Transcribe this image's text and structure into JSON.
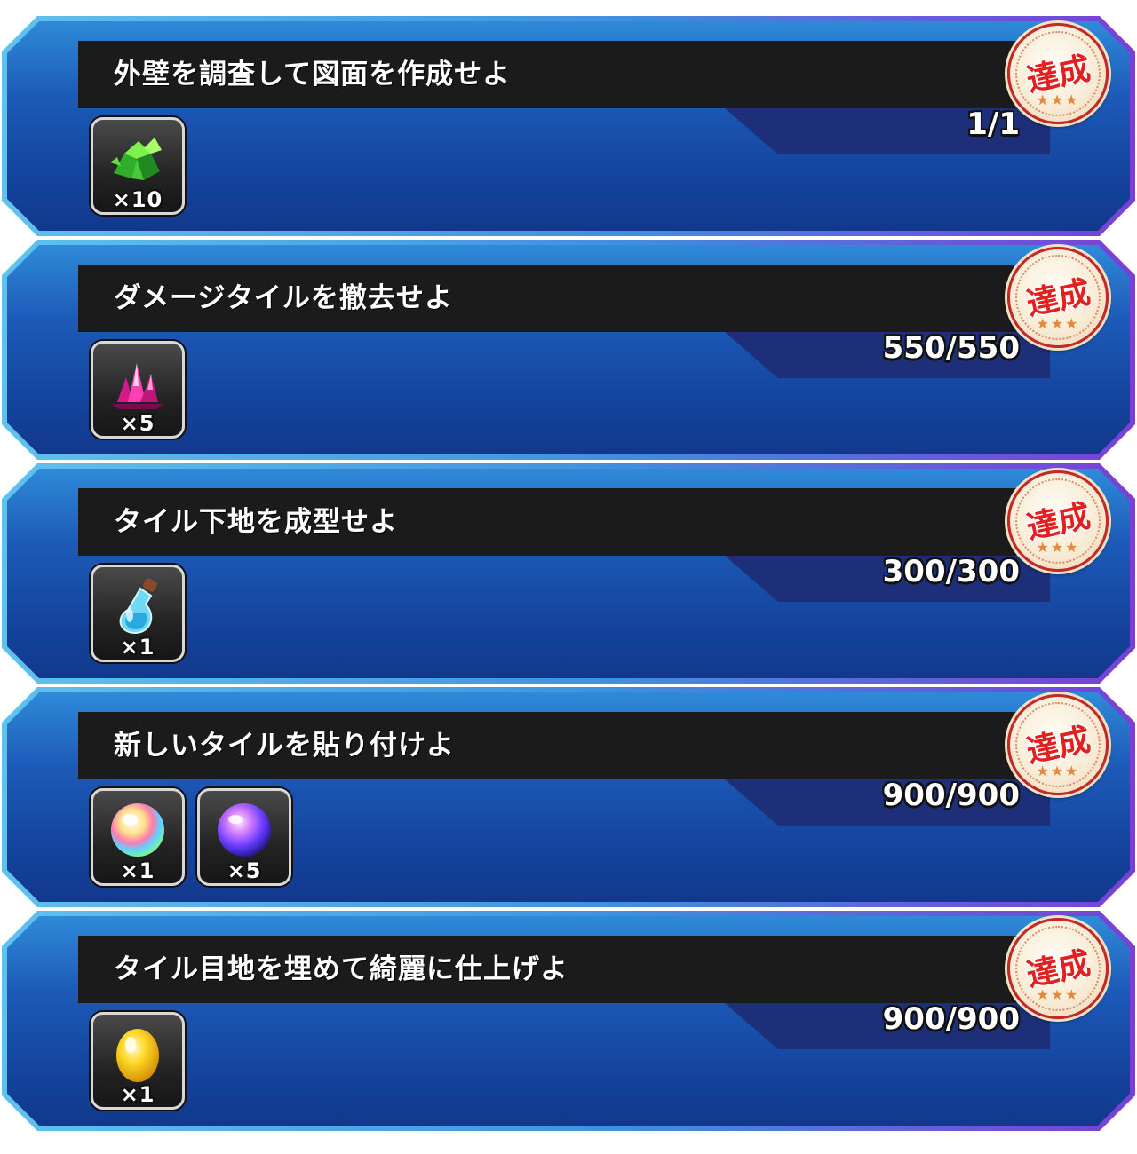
{
  "missions": [
    {
      "title": "外壁を調査して図面を作成せよ",
      "progress": "1/1",
      "badge": "達成",
      "rewards": [
        {
          "icon": "green-crystal-icon",
          "qty": "×10"
        }
      ]
    },
    {
      "title": "ダメージタイルを撤去せよ",
      "progress": "550/550",
      "badge": "達成",
      "rewards": [
        {
          "icon": "pink-crystal-icon",
          "qty": "×5"
        }
      ]
    },
    {
      "title": "タイル下地を成型せよ",
      "progress": "300/300",
      "badge": "達成",
      "rewards": [
        {
          "icon": "potion-bottle-icon",
          "qty": "×1"
        }
      ]
    },
    {
      "title": "新しいタイルを貼り付けよ",
      "progress": "900/900",
      "badge": "達成",
      "rewards": [
        {
          "icon": "rainbow-orb-icon",
          "qty": "×1"
        },
        {
          "icon": "purple-orb-icon",
          "qty": "×5"
        }
      ]
    },
    {
      "title": "タイル目地を埋めて綺麗に仕上げよ",
      "progress": "900/900",
      "badge": "達成",
      "rewards": [
        {
          "icon": "golden-egg-icon",
          "qty": "×1"
        }
      ]
    }
  ],
  "colors": {
    "card_inner": "#1d5bb8",
    "title_bar": "#1b1b1b",
    "progress_band": "#1c2f78",
    "badge_text": "#e32020"
  }
}
